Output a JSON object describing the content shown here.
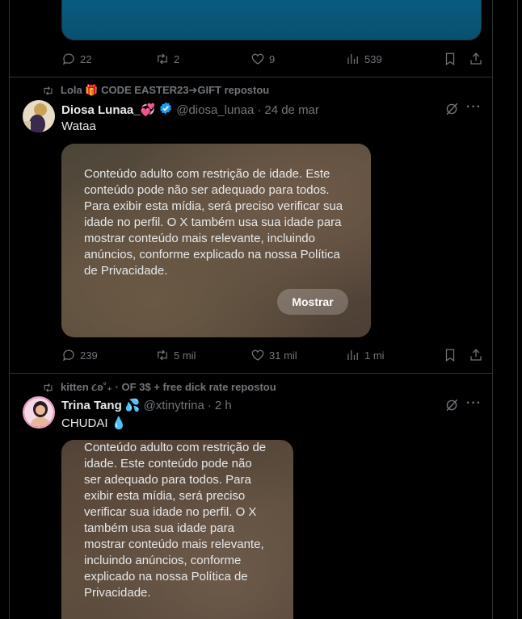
{
  "colors": {
    "background": "#000000",
    "border": "#2f3336",
    "muted": "#71767b",
    "text": "#e7e9ea",
    "accent": "#1d9bf0"
  },
  "post0": {
    "stats": {
      "replies": "22",
      "reposts": "2",
      "likes": "9",
      "views": "539"
    }
  },
  "post1": {
    "repost_by": "Lola 🎁 CODE EASTER23➔GIFT repostou",
    "name": "Diosa Lunaa_💞",
    "handle": "@diosa_lunaa",
    "dot": "·",
    "time": "24 de mar",
    "text": "Wataa",
    "media_notice": "Conteúdo adulto com restrição de idade. Este conteúdo pode não ser adequado para todos. Para exibir esta mídia, será preciso verificar sua idade no perfil. O X também usa sua idade para mostrar conteúdo mais relevante, incluindo anúncios, conforme explicado na nossa Política de Privacidade.",
    "show_label": "Mostrar",
    "stats": {
      "replies": "239",
      "reposts": "5 mil",
      "likes": "31 mil",
      "views": "1 mi"
    },
    "verified_icon": "verified-badge-icon"
  },
  "post2": {
    "repost_by": "kitten ૮ʚ˚₊ · OF 3$ + free dick rate repostou",
    "name": "Trina Tang 💦",
    "handle": "@xtinytrina",
    "dot": "·",
    "time": "2 h",
    "text": "CHUDAI 💧",
    "media_notice": "Conteúdo adulto com restrição de idade. Este conteúdo pode não ser adequado para todos. Para exibir esta mídia, será preciso verificar sua idade no perfil. O X também usa sua idade para mostrar conteúdo mais relevante, incluindo anúncios, conforme explicado na nossa Política de Privacidade."
  }
}
